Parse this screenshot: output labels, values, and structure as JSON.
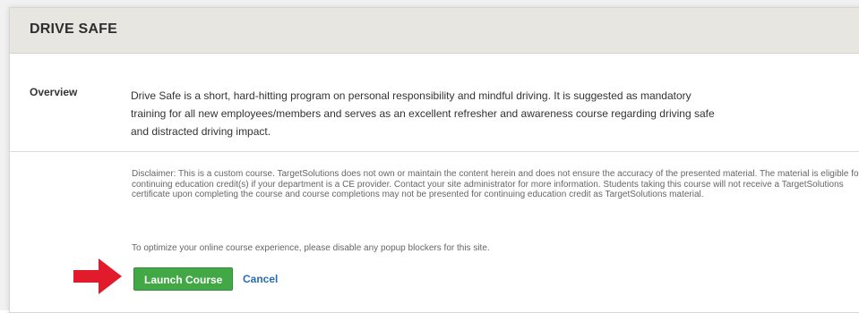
{
  "course": {
    "title": "DRIVE SAFE",
    "overview_label": "Overview",
    "overview_text": "Drive Safe is a short, hard-hitting program on personal responsibility and mindful driving. It is suggested as mandatory training for all new employees/members and serves as an excellent refresher and awareness course regarding driving safe and distracted driving impact.",
    "disclaimer": "Disclaimer: This is a custom course. TargetSolutions does not own or maintain the content herein and does not ensure the accuracy of the presented material. The material is eligible for continuing education credit(s) if your department is a CE provider. Contact your site administrator for more information. Students taking this course will not receive a TargetSolutions certificate upon completing the course and course completions may not be presented for continuing education credit as TargetSolutions material.",
    "popup_note": "To optimize your online course experience, please disable any popup blockers for this site."
  },
  "actions": {
    "launch_label": "Launch Course",
    "cancel_label": "Cancel"
  },
  "annotations": {
    "arrow_icon": "red-arrow-right-icon",
    "arrow_color": "#e21b2c"
  },
  "colors": {
    "header_bg": "#e7e6e1",
    "launch_button": "#42a846",
    "cancel_link": "#2a6cb3"
  }
}
